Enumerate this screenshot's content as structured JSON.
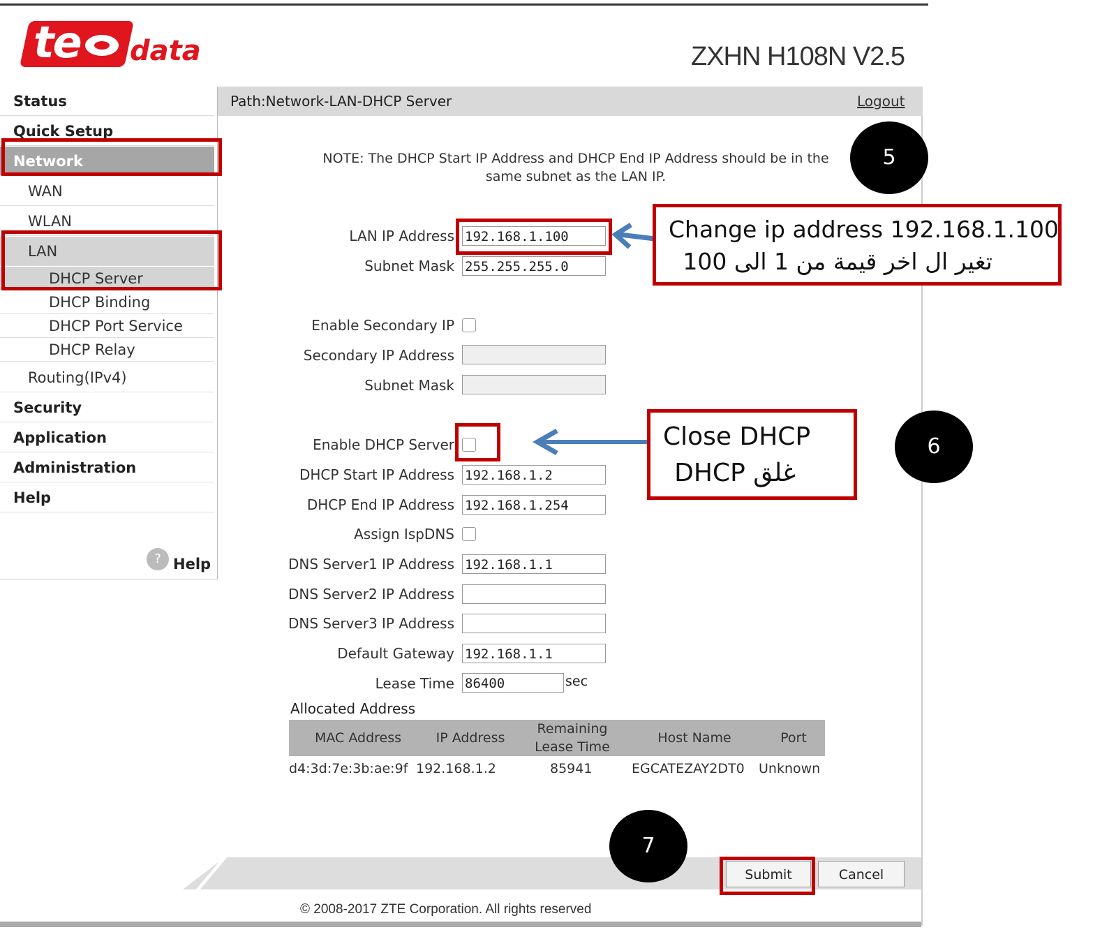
{
  "brand": {
    "logo_text": "te",
    "logo_sub": "data",
    "model": "ZXHN H108N V2.5"
  },
  "sidebar": {
    "items": [
      {
        "label": "Status"
      },
      {
        "label": "Quick Setup"
      },
      {
        "label": "Network"
      },
      {
        "label": "WAN"
      },
      {
        "label": "WLAN"
      },
      {
        "label": "LAN"
      },
      {
        "label": "DHCP Server"
      },
      {
        "label": "DHCP Binding"
      },
      {
        "label": "DHCP Port Service"
      },
      {
        "label": "DHCP Relay"
      },
      {
        "label": "Routing(IPv4)"
      },
      {
        "label": "Security"
      },
      {
        "label": "Application"
      },
      {
        "label": "Administration"
      },
      {
        "label": "Help"
      }
    ],
    "help_label": "Help",
    "help_icon": "?"
  },
  "header": {
    "path": "Path:Network-LAN-DHCP Server",
    "logout": "Logout"
  },
  "note": "NOTE: The DHCP Start IP Address and DHCP End IP Address should be in the same subnet as the LAN IP.",
  "form": {
    "lan_ip_label": "LAN IP Address",
    "lan_ip": "192.168.1.100",
    "subnet_label": "Subnet Mask",
    "subnet": "255.255.255.0",
    "enable_secondary_label": "Enable Secondary IP",
    "secondary_ip_label": "Secondary IP Address",
    "secondary_subnet_label": "Subnet Mask",
    "enable_dhcp_label": "Enable DHCP Server",
    "dhcp_start_label": "DHCP Start IP Address",
    "dhcp_start": "192.168.1.2",
    "dhcp_end_label": "DHCP End IP Address",
    "dhcp_end": "192.168.1.254",
    "assign_isp_label": "Assign IspDNS",
    "dns1_label": "DNS Server1 IP Address",
    "dns1": "192.168.1.1",
    "dns2_label": "DNS Server2 IP Address",
    "dns2": "",
    "dns3_label": "DNS Server3 IP Address",
    "dns3": "",
    "gateway_label": "Default Gateway",
    "gateway": "192.168.1.1",
    "lease_label": "Lease Time",
    "lease": "86400",
    "lease_unit": "sec"
  },
  "allocated": {
    "title": "Allocated Address",
    "columns": [
      "MAC Address",
      "IP Address",
      "Remaining Lease Time",
      "Host Name",
      "Port"
    ],
    "rows": [
      {
        "mac": "d4:3d:7e:3b:ae:9f",
        "ip": "192.168.1.2",
        "remaining": "85941",
        "host": "EGCATEZAY2DT0",
        "port": "Unknown"
      }
    ]
  },
  "buttons": {
    "submit": "Submit",
    "cancel": "Cancel"
  },
  "footer": "© 2008-2017 ZTE Corporation. All rights reserved",
  "annotations": {
    "step5": "5",
    "step6": "6",
    "step7": "7",
    "callout1_line1": "Change ip address 192.168.1.100",
    "callout1_line2": "تغير ال  اخر قيمة من 1 الى 100",
    "callout2_line1": "Close DHCP",
    "callout2_line2": "غلق  DHCP",
    "arrow_color": "#4a7ebb",
    "highlight_color": "#c00000"
  }
}
